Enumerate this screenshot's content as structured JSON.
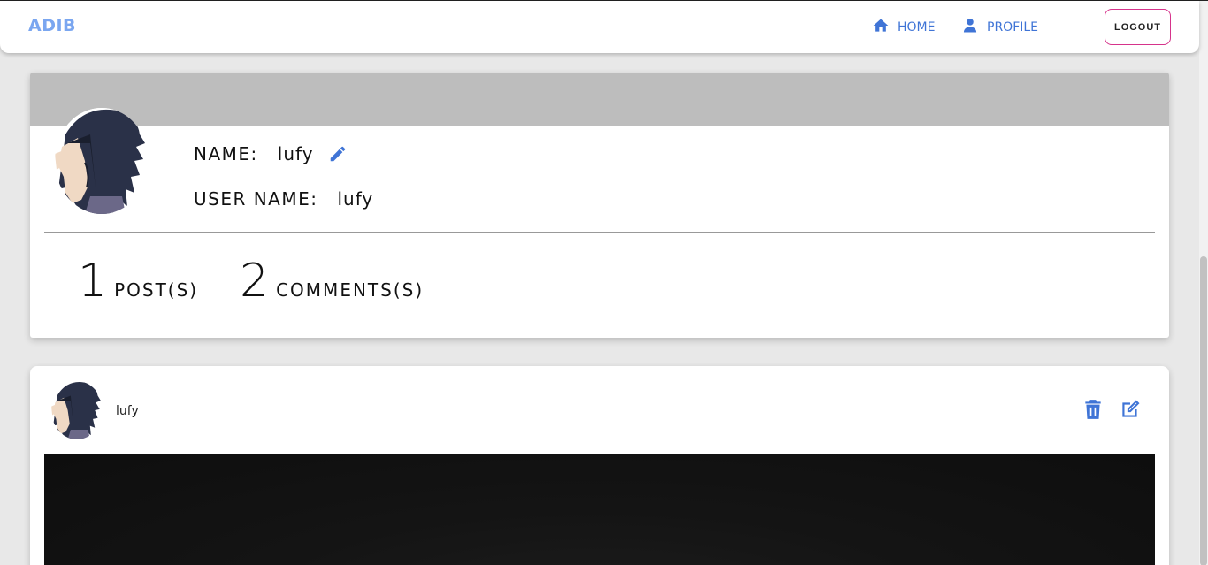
{
  "navbar": {
    "brand": "ADIB",
    "home_label": "HOME",
    "profile_label": "PROFILE",
    "logout_label": "LOGOUT",
    "home_icon": "home-icon",
    "profile_icon": "person-icon"
  },
  "profile": {
    "name_label": "NAME:",
    "name_value": "lufy",
    "username_label": "USER NAME:",
    "username_value": "lufy",
    "edit_icon": "pencil-icon",
    "stats": {
      "posts_count": "1",
      "posts_label": "POST(S)",
      "comments_count": "2",
      "comments_label": "COMMENTS(S)"
    }
  },
  "post": {
    "author": "lufy",
    "delete_icon": "trash-icon",
    "edit_icon": "edit-square-icon"
  },
  "colors": {
    "accent": "#3f74d6",
    "brand": "#7aa6f0",
    "logout_border": "#d6338b",
    "cover": "#bdbdbd",
    "background": "#e8e8e8"
  }
}
